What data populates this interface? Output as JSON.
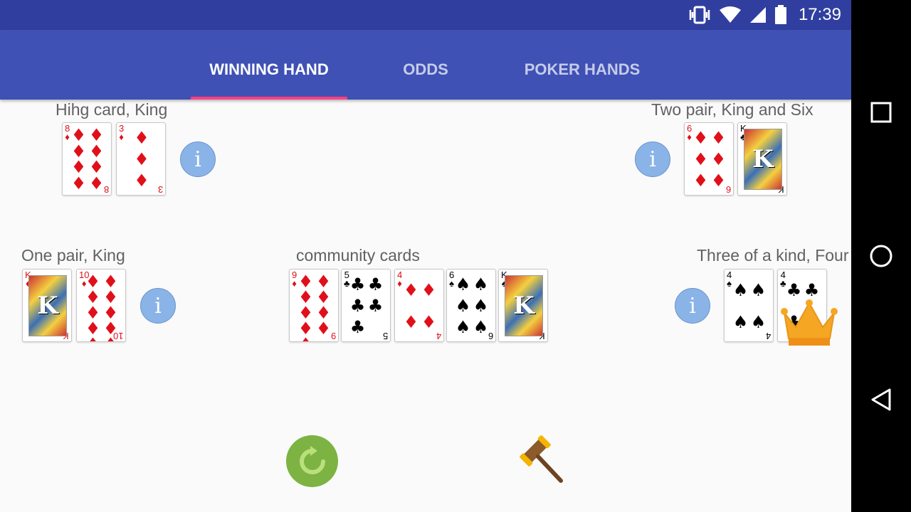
{
  "status": {
    "time": "17:39",
    "icons": [
      "vibrate-icon",
      "wifi-icon",
      "signal-icon",
      "battery-icon"
    ]
  },
  "tabs": [
    {
      "label": "WINNING HAND",
      "active": true
    },
    {
      "label": "ODDS",
      "active": false
    },
    {
      "label": "POKER HANDS",
      "active": false
    }
  ],
  "players": [
    {
      "id": "top-left",
      "hand": "Hihg card, King",
      "cards": [
        {
          "rank": "8",
          "suit": "♦"
        },
        {
          "rank": "3",
          "suit": "♦"
        }
      ]
    },
    {
      "id": "top-right",
      "hand": "Two pair, King and Six",
      "cards": [
        {
          "rank": "6",
          "suit": "♦"
        },
        {
          "rank": "K",
          "suit": "♣"
        }
      ]
    },
    {
      "id": "mid-left",
      "hand": "One pair, King",
      "cards": [
        {
          "rank": "K",
          "suit": "♦"
        },
        {
          "rank": "10",
          "suit": "♦"
        }
      ]
    },
    {
      "id": "mid-right",
      "hand": "Three of a kind, Four",
      "cards": [
        {
          "rank": "4",
          "suit": "♠"
        },
        {
          "rank": "4",
          "suit": "♣"
        }
      ],
      "winner": true
    }
  ],
  "community": {
    "label": "community cards",
    "cards": [
      {
        "rank": "9",
        "suit": "♦"
      },
      {
        "rank": "5",
        "suit": "♣"
      },
      {
        "rank": "4",
        "suit": "♦"
      },
      {
        "rank": "6",
        "suit": "♠"
      },
      {
        "rank": "K",
        "suit": "♠"
      }
    ]
  },
  "info_glyph": "i",
  "colors": {
    "statusbar": "#303f9f",
    "toolbar": "#3f51b5",
    "indicator": "#ff4081",
    "info": "#8ab4e8",
    "reload": "#7cb342",
    "crown": "#f5a623"
  }
}
